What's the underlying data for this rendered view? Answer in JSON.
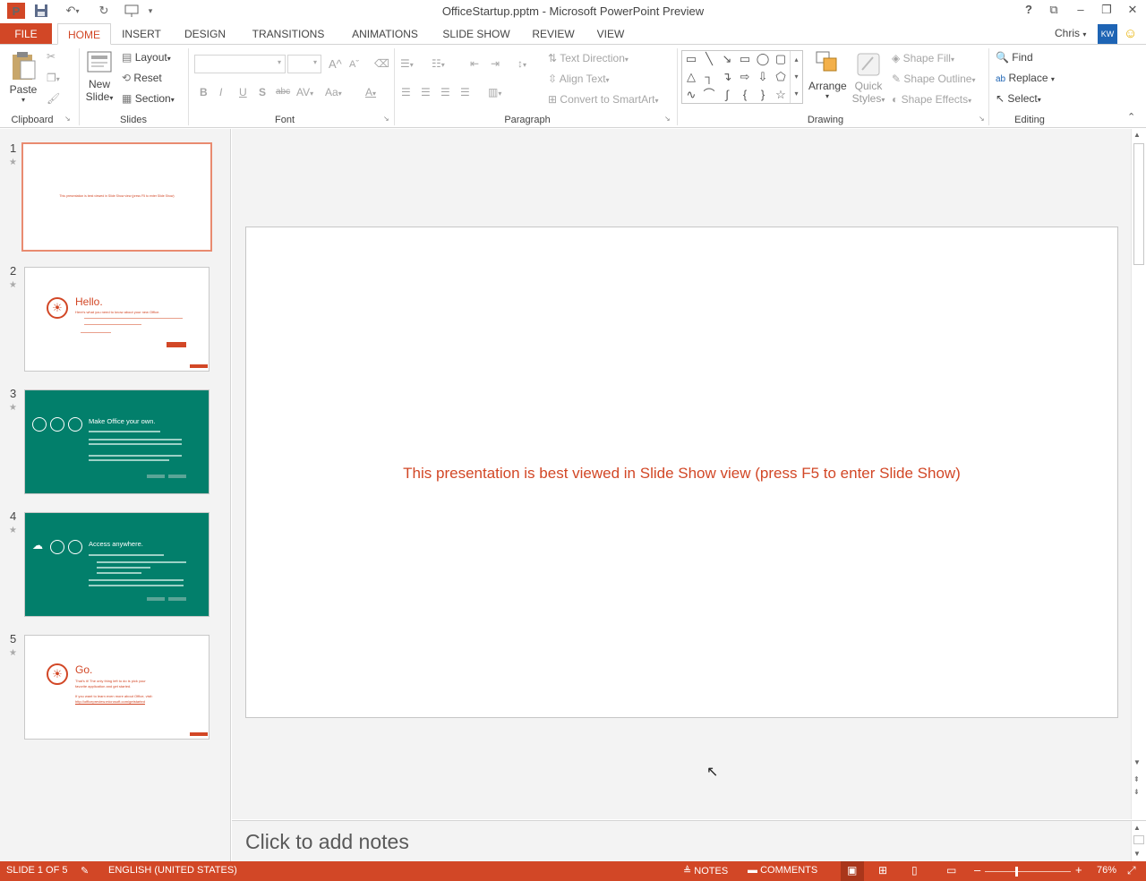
{
  "window": {
    "title": "OfficeStartup.pptm - Microsoft PowerPoint Preview",
    "app_icon_letter": "P",
    "help": "?",
    "user_name": "Chris",
    "user_initials": "KW"
  },
  "tabs": [
    "FILE",
    "HOME",
    "INSERT",
    "DESIGN",
    "TRANSITIONS",
    "ANIMATIONS",
    "SLIDE SHOW",
    "REVIEW",
    "VIEW"
  ],
  "ribbon": {
    "clipboard": {
      "paste": "Paste",
      "label": "Clipboard"
    },
    "slides": {
      "new_slide_1": "New",
      "new_slide_2": "Slide",
      "layout": "Layout",
      "reset": "Reset",
      "section": "Section",
      "label": "Slides"
    },
    "font": {
      "bold": "B",
      "italic": "I",
      "underline": "U",
      "shadow": "S",
      "strike": "abc",
      "spacing": "AV",
      "case": "Aa",
      "color": "A",
      "grow": "A",
      "shrink": "A",
      "label": "Font"
    },
    "paragraph": {
      "text_direction": "Text Direction",
      "align_text": "Align Text",
      "smartart": "Convert to SmartArt",
      "label": "Paragraph"
    },
    "drawing": {
      "arrange": "Arrange",
      "quick_styles_1": "Quick",
      "quick_styles_2": "Styles",
      "shape_fill": "Shape Fill",
      "shape_outline": "Shape Outline",
      "shape_effects": "Shape Effects",
      "label": "Drawing"
    },
    "editing": {
      "find": "Find",
      "replace": "Replace",
      "select": "Select",
      "label": "Editing"
    }
  },
  "thumbnails": [
    {
      "num": "1",
      "text": "This presentation is best viewed in Slide Show view (press F5 to enter Slide Show)"
    },
    {
      "num": "2",
      "title": "Hello.",
      "subtitle": "Here's what you need to know about your new Office."
    },
    {
      "num": "3",
      "title": "Make Office your own."
    },
    {
      "num": "4",
      "title": "Access anywhere."
    },
    {
      "num": "5",
      "title": "Go.",
      "line1": "That's it! The only thing left to do is pick your",
      "line2": "favorite application and get started.",
      "line3": "If you want to learn even more about Office, visit:",
      "link": "http://officepreview.microsoft.com/getstarted"
    }
  ],
  "slide": {
    "text": "This presentation is best viewed in Slide Show view (press F5 to enter Slide Show)"
  },
  "notes": {
    "placeholder": "Click to add notes"
  },
  "status": {
    "slide_counter": "SLIDE 1 OF 5",
    "language": "ENGLISH (UNITED STATES)",
    "notes": "NOTES",
    "comments": "COMMENTS",
    "zoom": "76%",
    "zoom_level": 0.76
  },
  "colors": {
    "accent": "#d24726",
    "green": "#027f6b"
  }
}
